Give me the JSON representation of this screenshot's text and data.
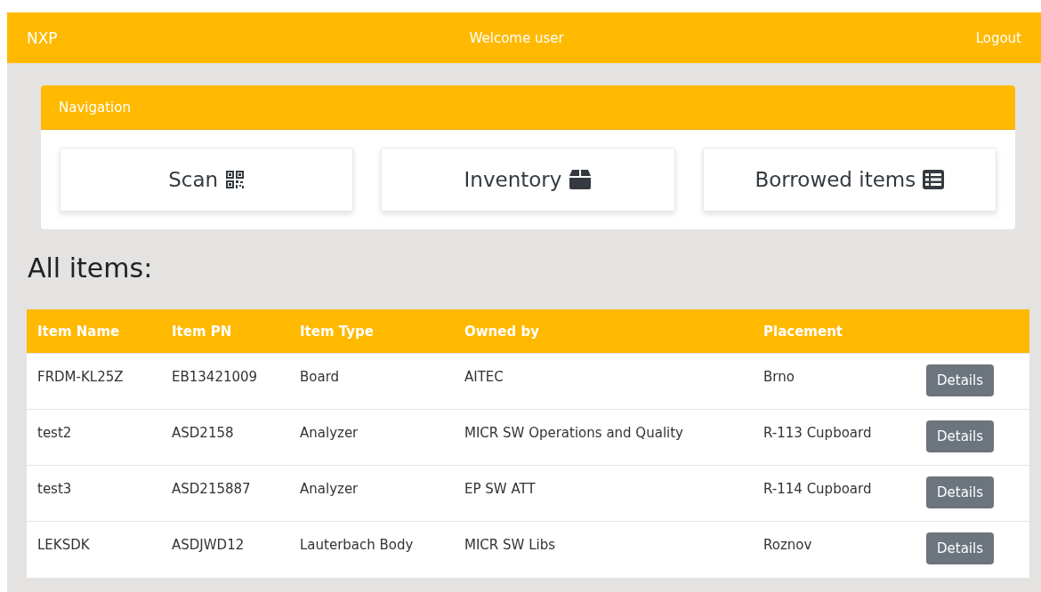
{
  "header": {
    "brand": "NXP",
    "welcome": "Welcome user",
    "logout": "Logout"
  },
  "navigation": {
    "title": "Navigation",
    "buttons": [
      {
        "label": "Scan",
        "kind": "scan"
      },
      {
        "label": "Inventory",
        "kind": "inventory"
      },
      {
        "label": "Borrowed items",
        "kind": "borrowed"
      }
    ]
  },
  "heading": "All items:",
  "table": {
    "columns": [
      "Item Name",
      "Item PN",
      "Item Type",
      "Owned by",
      "Placement"
    ],
    "rows": [
      {
        "cells": [
          "FRDM-KL25Z",
          "EB13421009",
          "Board",
          "AITEC",
          "Brno"
        ],
        "action": "Details"
      },
      {
        "cells": [
          "test2",
          "ASD2158",
          "Analyzer",
          "MICR SW Operations and Quality",
          "R-113 Cupboard"
        ],
        "action": "Details"
      },
      {
        "cells": [
          "test3",
          "ASD215887",
          "Analyzer",
          "EP SW ATT",
          "R-114 Cupboard"
        ],
        "action": "Details"
      },
      {
        "cells": [
          "LEKSDK",
          "ASDJWD12",
          "Lauterbach Body",
          "MICR SW Libs",
          "Roznov"
        ],
        "action": "Details"
      }
    ]
  }
}
